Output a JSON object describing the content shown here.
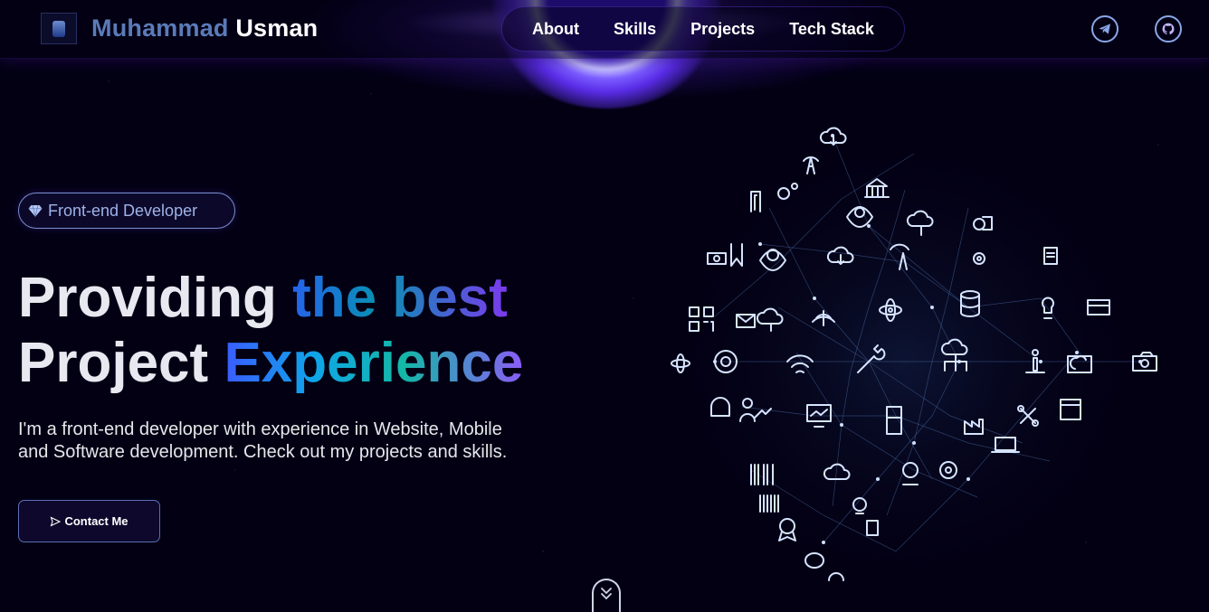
{
  "navbar": {
    "brand_first": "Muhammad",
    "brand_last": "Usman",
    "links": [
      "About",
      "Skills",
      "Projects",
      "Tech Stack"
    ],
    "social": [
      "telegram-icon",
      "github-icon"
    ]
  },
  "hero": {
    "badge": "Front-end Developer",
    "headline_line1_a": "Providing",
    "headline_line1_b": "the best",
    "headline_line2_a": "Project",
    "headline_line2_b": "Experience",
    "intro": "I'm a front-end developer with experience in Website, Mobile and Software development. Check out my projects and skills.",
    "contact_label": "Contact Me"
  },
  "colors": {
    "background": "#030014",
    "accent": "#7042f8",
    "brand_first": "#5b7bb8"
  }
}
